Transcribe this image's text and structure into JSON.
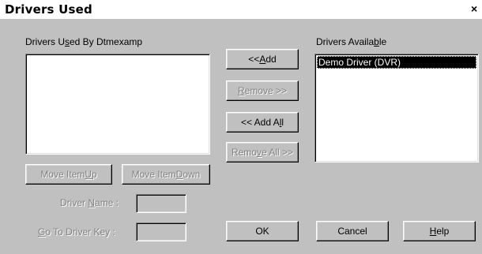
{
  "window": {
    "title": "Drivers Used",
    "close_glyph": "×",
    "close_icon": "close-icon"
  },
  "left_panel": {
    "label_pre": "Drivers U",
    "label_u": "s",
    "label_post": "ed By Dtmexamp",
    "items": []
  },
  "right_panel": {
    "label_pre": "Drivers Availa",
    "label_u": "b",
    "label_post": "le",
    "items": [
      {
        "label": "Demo Driver (DVR)",
        "selected": true
      }
    ]
  },
  "buttons": {
    "add": {
      "pre": "<< ",
      "u": "A",
      "post": "dd"
    },
    "remove": {
      "pre": "",
      "u": "R",
      "post": "emove >>"
    },
    "add_all": {
      "pre": "<< Add A",
      "u": "l",
      "post": "l"
    },
    "remove_all": {
      "pre": "Remo",
      "u": "v",
      "post": "e All >>"
    },
    "move_up": {
      "pre": "Move Item ",
      "u": "U",
      "post": "p"
    },
    "move_down": {
      "pre": "Move Item ",
      "u": "D",
      "post": "own"
    },
    "ok": "OK",
    "cancel": "Cancel",
    "help": {
      "pre": "",
      "u": "H",
      "post": "elp"
    }
  },
  "fields": {
    "driver_name": {
      "pre": "Driver ",
      "u": "N",
      "post": "ame :",
      "value": ""
    },
    "goto_key": {
      "pre": "",
      "u": "G",
      "post": "o To Driver Key :",
      "value": ""
    }
  }
}
